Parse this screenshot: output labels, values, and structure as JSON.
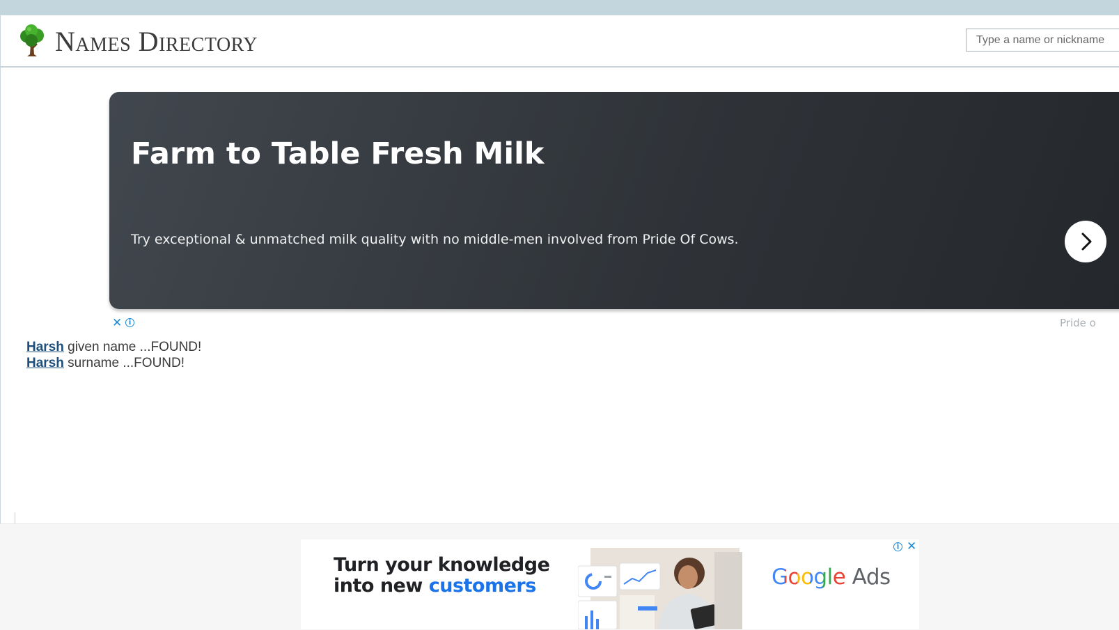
{
  "site": {
    "title": "Names Directory",
    "logo_icon": "tree-icon"
  },
  "search": {
    "placeholder": "Type a name or nickname"
  },
  "ad_banner": {
    "title": "Farm to Table Fresh Milk",
    "description": "Try exceptional & unmatched milk quality with no middle-men involved from Pride Of Cows.",
    "next_icon": "chevron-right-icon",
    "close_icon": "close-icon",
    "info_icon": "info-icon",
    "close_glyph": "✕",
    "info_glyph": "i",
    "advertiser": "Pride o"
  },
  "results": [
    {
      "name": "Harsh",
      "text": "given name ...FOUND!"
    },
    {
      "name": "Harsh",
      "text": "surname ...FOUND!"
    }
  ],
  "bottom_ad": {
    "headline_line1": "Turn your knowledge",
    "headline_line2_prefix": "into new ",
    "headline_line2_accent": "customers",
    "brand_word": "Google",
    "brand_suffix": " Ads",
    "info_glyph": "i",
    "close_glyph": "✕"
  },
  "colors": {
    "top_strip": "#c3d6de",
    "link": "#1d4f7c",
    "ad_bg": "#2f3338",
    "accent_blue": "#1a73e8",
    "google_blue": "#4285f4",
    "google_red": "#ea4335",
    "google_yellow": "#fbbc05",
    "google_green": "#34a853"
  }
}
